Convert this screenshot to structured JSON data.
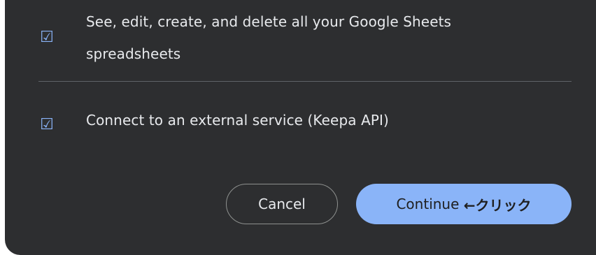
{
  "scopes": [
    {
      "checked_glyph": "☑",
      "text": "See, edit, create, and delete all your Google Sheets spreadsheets"
    },
    {
      "checked_glyph": "☑",
      "text": "Connect to an external service (Keepa API)"
    }
  ],
  "actions": {
    "cancel_label": "Cancel",
    "continue_label": "Continue ",
    "continue_annotation": "←クリック"
  },
  "colors": {
    "dialog_bg": "#2d2e30",
    "accent": "#8ab4f8",
    "text": "#e8eaed",
    "divider": "#5f6368"
  },
  "icons": {
    "checkbox": "checked-checkbox-icon"
  }
}
